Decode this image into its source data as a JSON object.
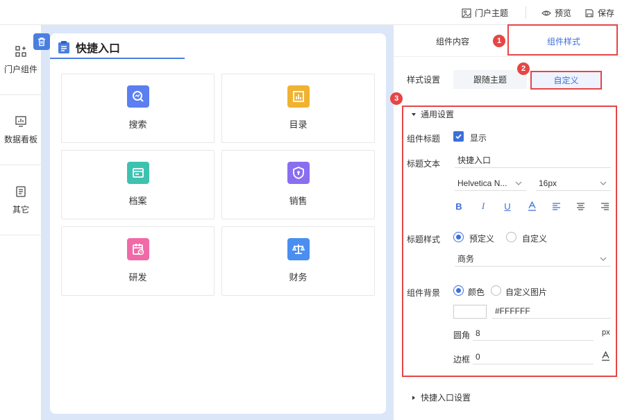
{
  "topbar": {
    "theme_label": "门户主题",
    "preview_label": "预览",
    "save_label": "保存"
  },
  "leftnav": {
    "items": [
      {
        "label": "门户组件",
        "icon": "components-icon"
      },
      {
        "label": "数据看板",
        "icon": "dashboard-icon"
      },
      {
        "label": "其它",
        "icon": "other-icon"
      }
    ]
  },
  "canvas": {
    "title": "快捷入口",
    "tiles": [
      {
        "label": "搜索",
        "icon": "search-icon",
        "color": "#5b7ff0"
      },
      {
        "label": "目录",
        "icon": "chart-icon",
        "color": "#f0b232"
      },
      {
        "label": "档案",
        "icon": "card-icon",
        "color": "#3ec2b0"
      },
      {
        "label": "销售",
        "icon": "shield-icon",
        "color": "#8a6ef0"
      },
      {
        "label": "研发",
        "icon": "calendar-icon",
        "color": "#f06aa8"
      },
      {
        "label": "财务",
        "icon": "scale-icon",
        "color": "#4a8ef0"
      }
    ]
  },
  "panel": {
    "tab_content": "组件内容",
    "tab_style": "组件样式",
    "style_setting_label": "样式设置",
    "follow_theme": "跟随主题",
    "custom": "自定义",
    "general_section": "通用设置",
    "comp_title_label": "组件标题",
    "show_label": "显示",
    "title_text_label": "标题文本",
    "title_text_value": "快捷入口",
    "font_family": "Helvetica N...",
    "font_size": "16px",
    "title_style_label": "标题样式",
    "predefined": "预定义",
    "custom_style": "自定义",
    "style_value": "商务",
    "bg_label": "组件背景",
    "color_option": "颜色",
    "custom_image": "自定义图片",
    "color_hex": "#FFFFFF",
    "radius_label": "圆角",
    "radius_value": "8",
    "radius_unit": "px",
    "border_label": "边框",
    "border_value": "0",
    "quick_section": "快捷入口设置",
    "badges": [
      "1",
      "2",
      "3"
    ]
  },
  "colors": {
    "accent": "#3c6fdb",
    "annotation": "#e64545",
    "canvas_bg": "#dbe7f8"
  }
}
